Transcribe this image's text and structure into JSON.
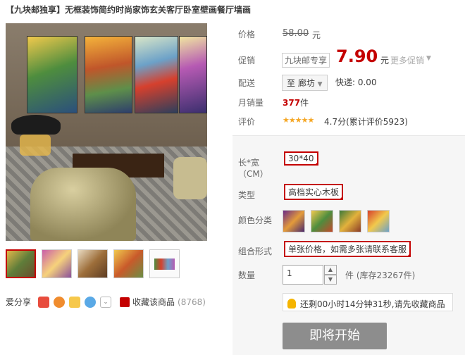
{
  "product": {
    "title": "【九块邮独享】无框装饰简约时尚家饰玄关客厅卧室壁画餐厅墙画"
  },
  "price": {
    "label": "价格",
    "original": "58.00",
    "unit": "元"
  },
  "promo": {
    "label": "促销",
    "tag": "九块邮专享",
    "price": "7.90",
    "unit": "元",
    "more": "更多促销"
  },
  "shipping": {
    "label": "配送",
    "destination": "至 廊坊",
    "fee": "快递: 0.00"
  },
  "sales": {
    "label": "月销量",
    "count": "377",
    "unit": "件"
  },
  "review": {
    "label": "评价",
    "stars": "★★★★★",
    "text": "4.7分(累计评价5923)"
  },
  "sku": {
    "size_label_1": "长*宽",
    "size_label_2": "（CM）",
    "size_value": "30*40",
    "type_label": "类型",
    "type_value": "高档实心木板",
    "color_label": "颜色分类",
    "combo_label": "组合形式",
    "combo_value": "单张价格，如需多张请联系客服"
  },
  "quantity": {
    "label": "数量",
    "value": "1",
    "stock": "件 (库存23267件)"
  },
  "countdown": {
    "text": "还剩00小时14分钟31秒,请先收藏商品"
  },
  "buy": {
    "label": "即将开始"
  },
  "share": {
    "label": "爱分享"
  },
  "favorite": {
    "label": "收藏该商品",
    "count": "(8768)"
  }
}
